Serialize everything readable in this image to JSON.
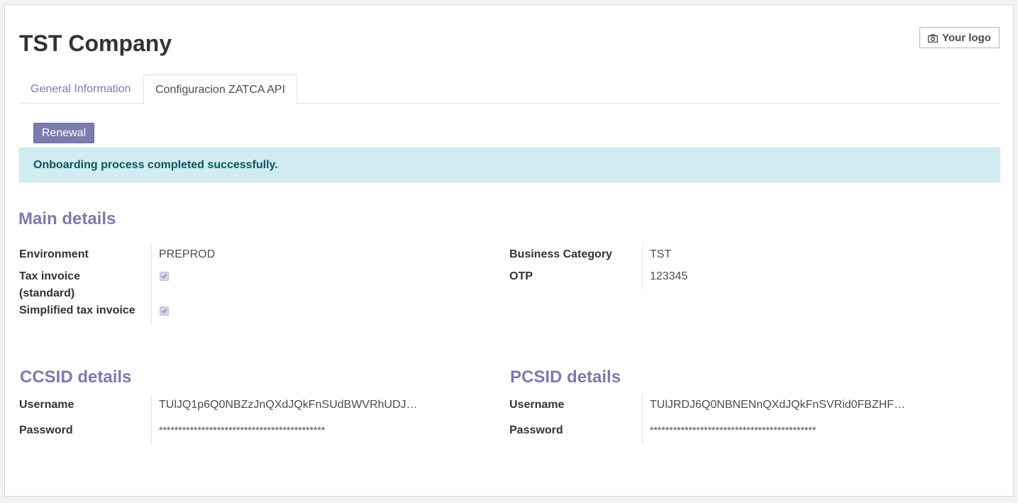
{
  "header": {
    "title": "TST Company",
    "logo_button": "Your logo",
    "logo_icon": "camera-icon"
  },
  "tabs": [
    {
      "label": "General Information",
      "active": false
    },
    {
      "label": "Configuracion ZATCA API",
      "active": true
    }
  ],
  "actions": {
    "renewal_label": "Renewal"
  },
  "alert": {
    "message": "Onboarding process completed successfully."
  },
  "main_details": {
    "heading": "Main details",
    "environment_label": "Environment",
    "environment_value": "PREPROD",
    "tax_invoice_label_line1": "Tax invoice",
    "tax_invoice_label_line2": "(standard)",
    "tax_invoice_checked": true,
    "simplified_label": "Simplified tax invoice",
    "simplified_checked": true,
    "business_category_label": "Business Category",
    "business_category_value": "TST",
    "otp_label": "OTP",
    "otp_value": "123345"
  },
  "ccsid": {
    "heading": "CCSID details",
    "username_label": "Username",
    "username_value": "TUlJQ1p6Q0NBZzJnQXdJQkFnSUdBWVRhUDJ…",
    "password_label": "Password",
    "password_value": "*******************************************"
  },
  "pcsid": {
    "heading": "PCSID details",
    "username_label": "Username",
    "username_value": "TUlJRDJ6Q0NBNENnQXdJQkFnSVRid0FBZHF…",
    "password_label": "Password",
    "password_value": "*******************************************"
  },
  "colors": {
    "accent": "#7c7bad",
    "alert_bg": "#d1ecf1",
    "alert_text": "#0c5460"
  }
}
